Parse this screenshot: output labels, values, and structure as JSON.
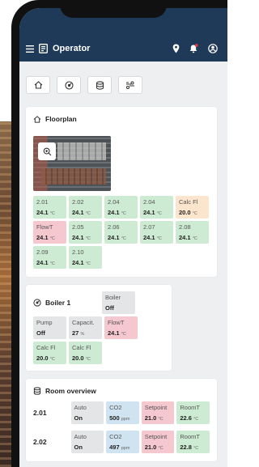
{
  "appbar": {
    "title": "Operator"
  },
  "toolbar": {
    "buttons": [
      {
        "icon": "home-icon"
      },
      {
        "icon": "gauge-icon"
      },
      {
        "icon": "layers-icon"
      },
      {
        "icon": "fan-icon"
      }
    ]
  },
  "floorplan": {
    "title": "Floorplan",
    "tiles": [
      {
        "name": "2.01",
        "value": "24.1",
        "unit": "°C",
        "status": "green"
      },
      {
        "name": "2.02",
        "value": "24.1",
        "unit": "°C",
        "status": "green"
      },
      {
        "name": "2.04",
        "value": "24.1",
        "unit": "°C",
        "status": "green"
      },
      {
        "name": "2.04",
        "value": "24.1",
        "unit": "°C",
        "status": "green"
      },
      {
        "name": "Calc Fl",
        "value": "20.0",
        "unit": "°C",
        "status": "orange"
      },
      {
        "name": "FlowT",
        "value": "24.1",
        "unit": "°C",
        "status": "red"
      },
      {
        "name": "2.05",
        "value": "24.1",
        "unit": "°C",
        "status": "green"
      },
      {
        "name": "2.06",
        "value": "24.1",
        "unit": "°C",
        "status": "green"
      },
      {
        "name": "2.07",
        "value": "24.1",
        "unit": "°C",
        "status": "green"
      },
      {
        "name": "2.08",
        "value": "24.1",
        "unit": "°C",
        "status": "green"
      },
      {
        "name": "2.09",
        "value": "24.1",
        "unit": "°C",
        "status": "green"
      },
      {
        "name": "2.10",
        "value": "24.1",
        "unit": "°C",
        "status": "green"
      }
    ]
  },
  "boiler": {
    "title": "Boiler 1",
    "tiles": [
      {
        "name": "Boiler",
        "value": "Off",
        "unit": "",
        "status": "neutral"
      },
      {
        "name": "Pump",
        "value": "Off",
        "unit": "",
        "status": "neutral"
      },
      {
        "name": "Capacit.",
        "value": "27",
        "unit": "%",
        "status": "neutral"
      },
      {
        "name": "FlowT",
        "value": "24.1",
        "unit": "°C",
        "status": "red"
      },
      {
        "name": "Calc Fl",
        "value": "20.0",
        "unit": "°C",
        "status": "green"
      },
      {
        "name": "Calc Fl",
        "value": "20.0",
        "unit": "°C",
        "status": "green"
      }
    ]
  },
  "rooms": {
    "title": "Room overview",
    "rows": [
      {
        "room": "2.01",
        "cells": [
          {
            "name": "Auto",
            "value": "On",
            "unit": "",
            "status": "neutral"
          },
          {
            "name": "CO2",
            "value": "500",
            "unit": "ppm",
            "status": "blue"
          },
          {
            "name": "Setpoint",
            "value": "21.0",
            "unit": "°C",
            "status": "red"
          },
          {
            "name": "RoomT",
            "value": "22.6",
            "unit": "°C",
            "status": "green"
          }
        ]
      },
      {
        "room": "2.02",
        "cells": [
          {
            "name": "Auto",
            "value": "On",
            "unit": "",
            "status": "neutral"
          },
          {
            "name": "CO2",
            "value": "497",
            "unit": "ppm",
            "status": "blue"
          },
          {
            "name": "Setpoint",
            "value": "21.0",
            "unit": "°C",
            "status": "red"
          },
          {
            "name": "RoomT",
            "value": "22.8",
            "unit": "°C",
            "status": "green"
          }
        ]
      }
    ]
  },
  "colors": {
    "appbar": "#1f3a58",
    "green": "#cdebd3",
    "red": "#f5c7cf",
    "orange": "#fbe5cd",
    "blue": "#cfe3f0",
    "neutral": "#e4e5e7"
  }
}
